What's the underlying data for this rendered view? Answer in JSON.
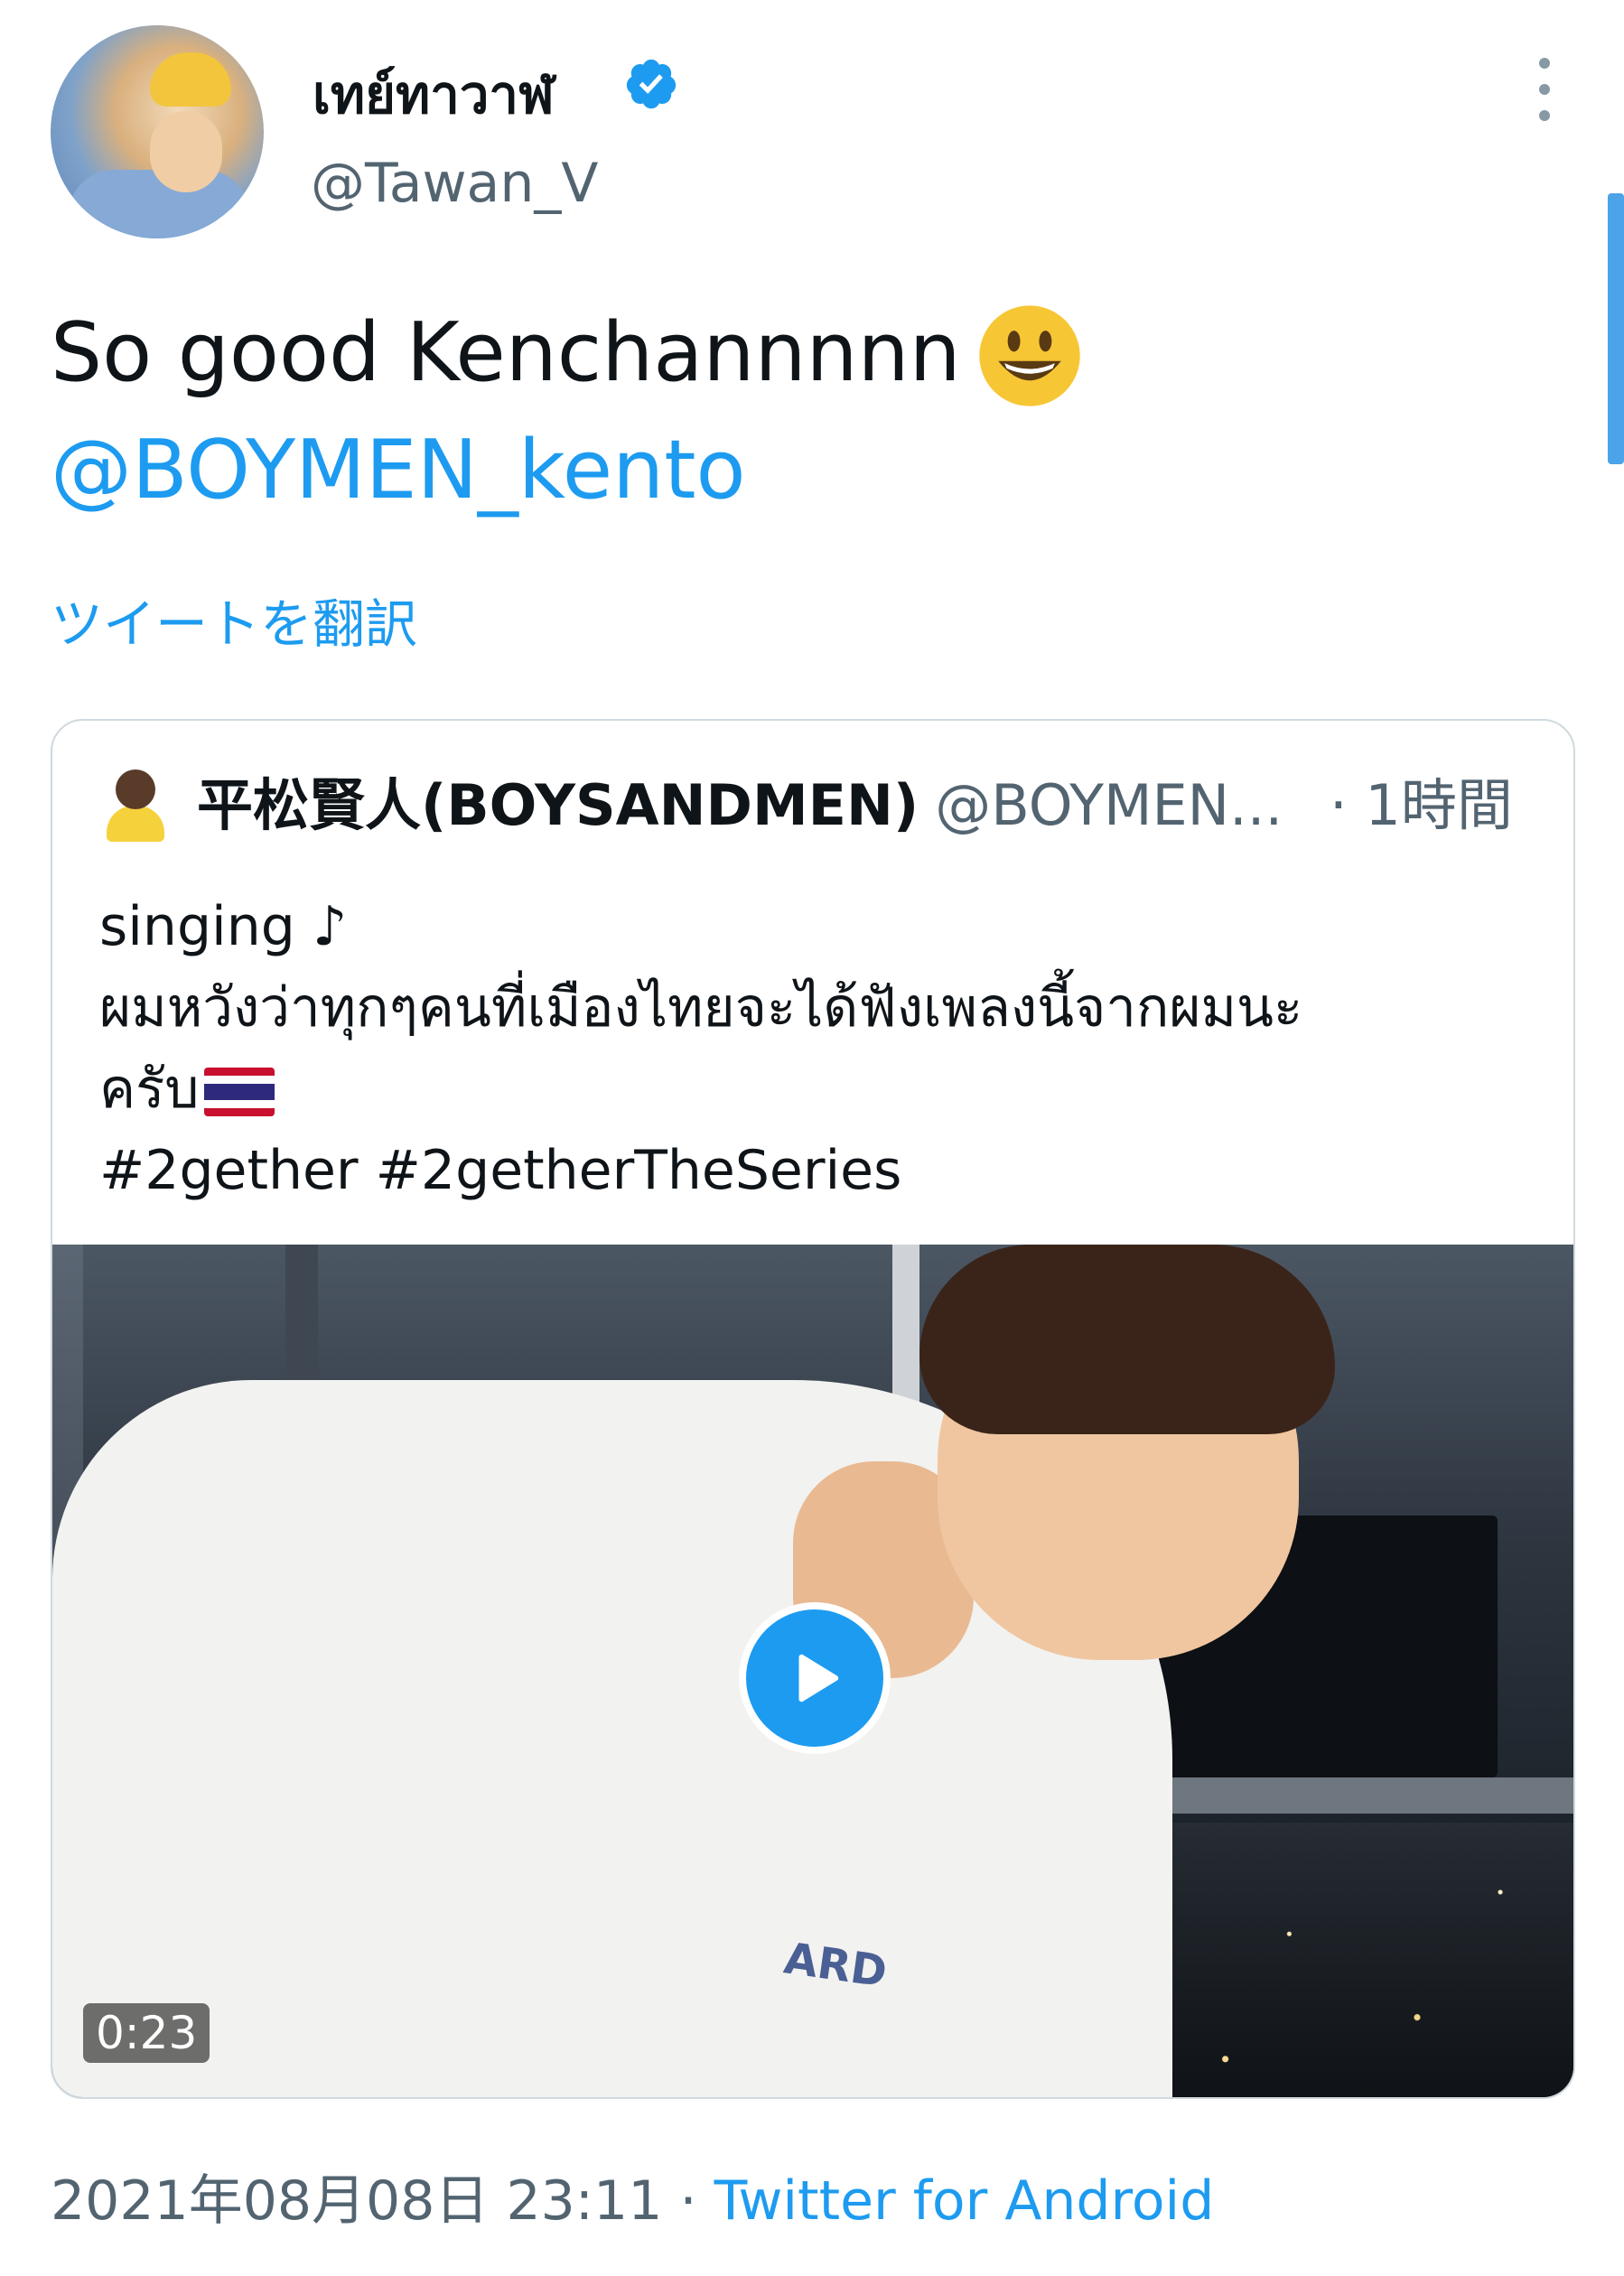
{
  "tweet": {
    "author": {
      "display_name": "เทย์ทาวาฬ",
      "handle": "@Tawan_V",
      "verified": true
    },
    "text": "So good Kenchannnnn",
    "emoji": "smiley-face",
    "mention": "@BOYMEN_kento",
    "translate_label": "ツイートを翻訳",
    "timestamp": "2021年08月08日 23:11",
    "separator": " · ",
    "source": "Twitter for Android"
  },
  "quoted_tweet": {
    "author_name": "平松賢人(BOYSANDMEN)",
    "author_handle": "@BOYMEN...",
    "time": "· 1時間",
    "lines": [
      "singing ♪",
      "ผมหวังว่าทุกๆคนที่เมืองไทยจะได้ฟังเพลงนี้จากผมนะ",
      "ครับ",
      "#2gether #2getherTheSeries"
    ],
    "flag": "thailand-flag",
    "video": {
      "duration": "0:23",
      "shirt_text": "ARD"
    }
  },
  "colors": {
    "accent": "#1d9bf0",
    "text": "#0f1419",
    "secondary": "#536471",
    "border": "#cfd9de"
  }
}
